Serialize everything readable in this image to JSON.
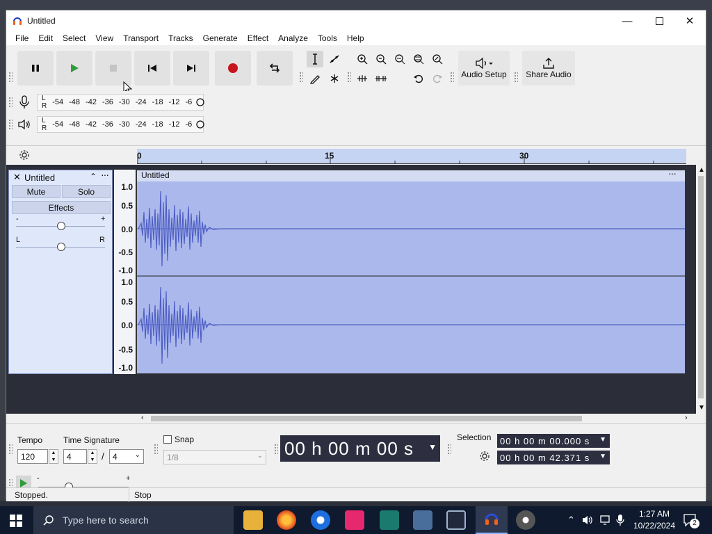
{
  "window": {
    "title": "Untitled"
  },
  "menu": [
    "File",
    "Edit",
    "Select",
    "View",
    "Transport",
    "Tracks",
    "Generate",
    "Effect",
    "Analyze",
    "Tools",
    "Help"
  ],
  "toolbar": {
    "audio_setup_label": "Audio Setup",
    "share_audio_label": "Share Audio"
  },
  "meters": {
    "recording_channels": [
      "L",
      "R"
    ],
    "playback_channels": [
      "L",
      "R"
    ],
    "scale": [
      "-54",
      "-48",
      "-42",
      "-36",
      "-30",
      "-24",
      "-18",
      "-12",
      "-6"
    ]
  },
  "ruler": {
    "ticks": [
      "0",
      "15",
      "30"
    ]
  },
  "track": {
    "name": "Untitled",
    "mute_label": "Mute",
    "solo_label": "Solo",
    "effects_label": "Effects",
    "pan_left": "L",
    "pan_right": "R",
    "gain_min": "-",
    "gain_max": "+",
    "clip_name": "Untitled",
    "scale_labels": [
      "1.0",
      "0.5",
      "0.0",
      "-0.5",
      "-1.0"
    ]
  },
  "bottom": {
    "tempo_label": "Tempo",
    "tempo_value": "120",
    "time_sig_label": "Time Signature",
    "time_sig_num": "4",
    "time_sig_sep": "/",
    "time_sig_den": "4",
    "snap_label": "Snap",
    "snap_value": "1/8",
    "time_display": "00 h 00 m 00 s",
    "selection_label": "Selection",
    "selection_start": "00 h 00 m 00.000 s",
    "selection_end": "00 h 00 m 42.371 s"
  },
  "status": {
    "left": "Stopped.",
    "right": "Stop"
  },
  "taskbar": {
    "search_placeholder": "Type here to search",
    "time": "1:27 AM",
    "date": "10/22/2024",
    "notification_count": "2"
  }
}
